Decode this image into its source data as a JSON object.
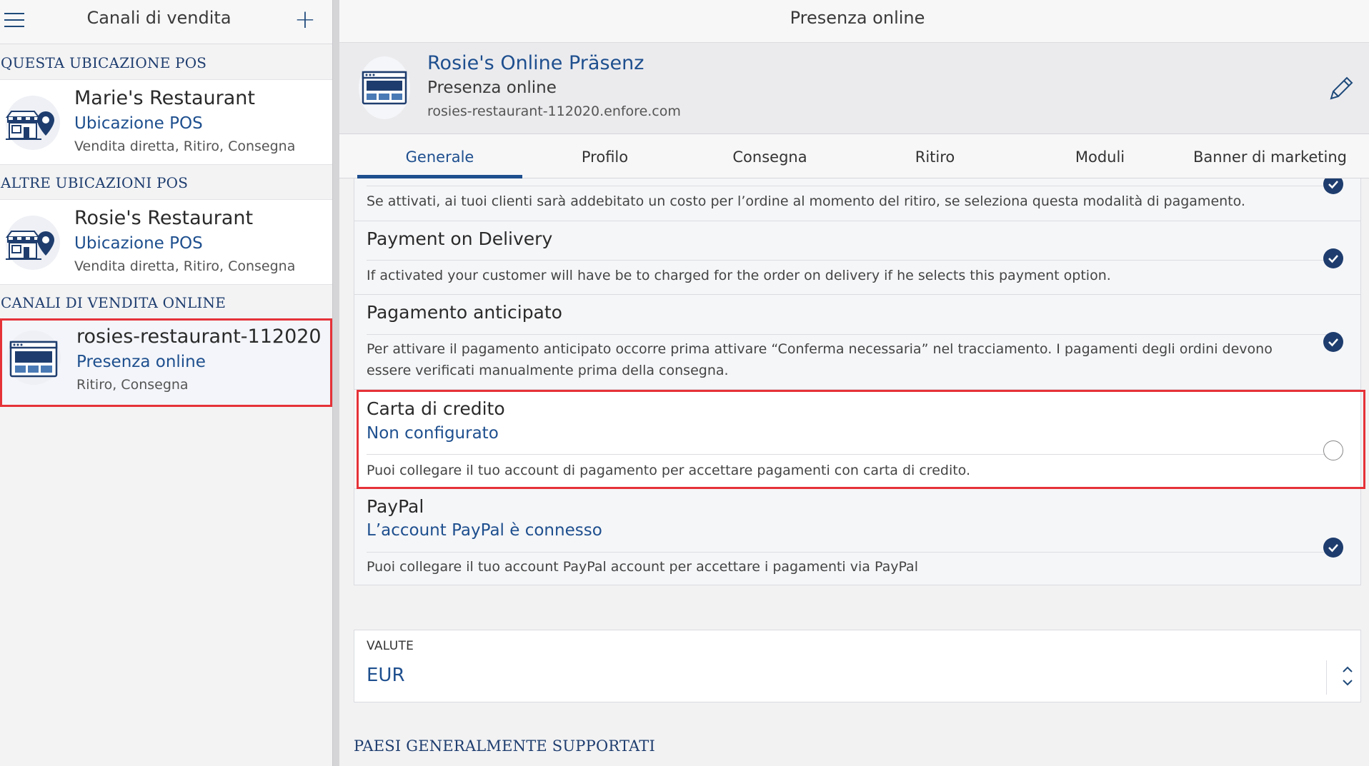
{
  "left": {
    "title": "Canali di vendita",
    "sections": {
      "this_pos": "QUESTA UBICAZIONE POS",
      "other_pos": "ALTRE UBICAZIONI POS",
      "online": "CANALI DI VENDITA ONLINE"
    },
    "items": [
      {
        "name": "Marie's Restaurant",
        "type": "Ubicazione POS",
        "sub": "Vendita diretta, Ritiro, Consegna"
      },
      {
        "name": "Rosie's Restaurant",
        "type": "Ubicazione POS",
        "sub": "Vendita diretta, Ritiro, Consegna"
      },
      {
        "name": "rosies-restaurant-112020",
        "type": "Presenza online",
        "sub": "Ritiro, Consegna"
      }
    ]
  },
  "right": {
    "title": "Presenza online",
    "presence": {
      "name": "Rosie's Online Präsenz",
      "type": "Presenza online",
      "url": "rosies-restaurant-112020.enfore.com"
    },
    "tabs": [
      "Generale",
      "Profilo",
      "Consegna",
      "Ritiro",
      "Moduli",
      "Banner di marketing"
    ],
    "active_tab": "Generale",
    "payments": [
      {
        "title": "",
        "status": "",
        "desc": "Se attivati, ai tuoi clienti sarà addebitato un costo per l’ordine al momento del ritiro, se seleziona questa modalità di pagamento.",
        "enabled": true
      },
      {
        "title": "Payment on Delivery",
        "status": "",
        "desc": "If activated your customer will have be to charged for the order on delivery if he selects this payment option.",
        "enabled": true
      },
      {
        "title": "Pagamento anticipato",
        "status": "",
        "desc": "Per attivare il pagamento anticipato occorre prima attivare “Conferma necessaria” nel tracciamento. I pagamenti degli ordini devono essere verificati manualmente prima della consegna.",
        "enabled": true
      },
      {
        "title": "Carta di credito",
        "status": "Non configurato",
        "desc": "Puoi collegare il tuo account di pagamento per accettare pagamenti con carta di credito.",
        "enabled": false
      },
      {
        "title": "PayPal",
        "status": "L’account PayPal è connesso",
        "desc": "Puoi collegare il tuo account PayPal account per accettare i pagamenti via PayPal",
        "enabled": true
      }
    ],
    "currency": {
      "label": "VALUTE",
      "value": "EUR"
    },
    "countries_title": "PAESI GENERALMENTE SUPPORTATI"
  },
  "colors": {
    "accent": "#1e4f8e",
    "dark_blue": "#1e3d6e",
    "highlight": "#e53238",
    "background": "#f2f2f3"
  },
  "icons": {
    "menu": "hamburger-menu-icon",
    "add": "plus-icon",
    "store": "store-location-icon",
    "web": "web-presence-icon",
    "edit": "pencil-icon",
    "checked": "checkmark-circle-icon",
    "unchecked": "empty-radio-icon",
    "stepper": "chevron-up-down-icon"
  }
}
